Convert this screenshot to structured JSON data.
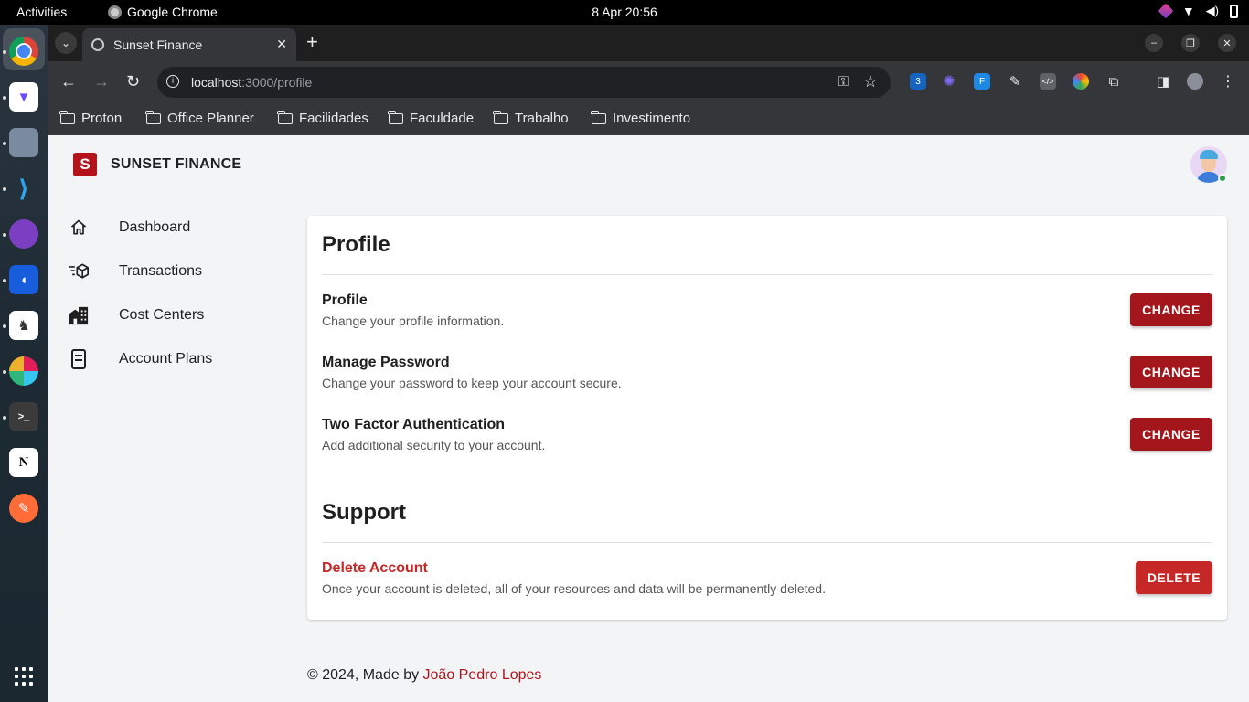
{
  "system": {
    "activities": "Activities",
    "app_name": "Google Chrome",
    "clock": "8 Apr  20:56"
  },
  "browser": {
    "tab_title": "Sunset Finance",
    "url_host": "localhost",
    "url_path": ":3000/profile",
    "extension_badge": "3",
    "bookmarks": [
      "Proton",
      "Office Planner",
      "Facilidades",
      "Faculdade",
      "Trabalho",
      "Investimento"
    ]
  },
  "app": {
    "brand_logo": "S",
    "brand_name": "SUNSET FINANCE",
    "nav": [
      {
        "label": "Dashboard",
        "icon": "home-icon"
      },
      {
        "label": "Transactions",
        "icon": "transactions-icon"
      },
      {
        "label": "Cost Centers",
        "icon": "building-icon"
      },
      {
        "label": "Account Plans",
        "icon": "document-icon"
      }
    ]
  },
  "profile": {
    "title": "Profile",
    "rows": [
      {
        "title": "Profile",
        "description": "Change your profile information.",
        "button": "CHANGE"
      },
      {
        "title": "Manage Password",
        "description": "Change your password to keep your account secure.",
        "button": "CHANGE"
      },
      {
        "title": "Two Factor Authentication",
        "description": "Add additional security to your account.",
        "button": "CHANGE"
      }
    ]
  },
  "support": {
    "title": "Support",
    "delete_title": "Delete Account",
    "delete_description": "Once your account is deleted, all of your resources and data will be permanently deleted.",
    "delete_button": "DELETE"
  },
  "footer": {
    "prefix": "© 2024, Made by ",
    "author": "João Pedro Lopes"
  },
  "colors": {
    "brand": "#b3141c",
    "danger": "#c62828",
    "page_bg": "#f3f4f6"
  }
}
